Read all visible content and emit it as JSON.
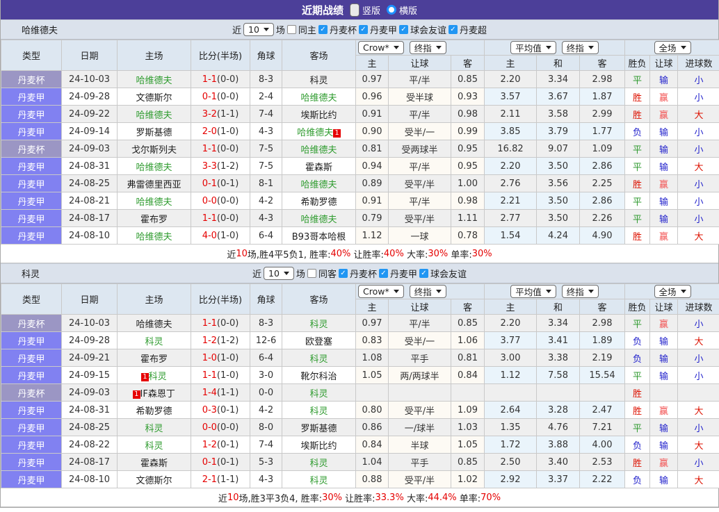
{
  "title_bar": {
    "title": "近期战绩",
    "vertical_label": "竖版",
    "horizontal_label": "横版"
  },
  "table_header": {
    "type": "类型",
    "date": "日期",
    "home": "主场",
    "score": "比分(半场)",
    "corner": "角球",
    "away": "客场",
    "crow_select": "Crow*",
    "final_select": "终指",
    "avg_select": "平均值",
    "full_select": "全场",
    "sub": {
      "home": "主",
      "handicap": "让球",
      "away": "客",
      "avg_home": "主",
      "avg_draw": "和",
      "avg_away": "客",
      "result": "胜负",
      "handicap_result": "让球",
      "goals": "进球数"
    }
  },
  "colors": {
    "accent_purple": "#4c3f99",
    "league_cup": "#9b96c4",
    "league_jia": "#8181f1",
    "team_green": "#2e9b2e",
    "score_red": "#e50000",
    "win_red": "#dd1100",
    "lose_blue": "#2222cc",
    "draw_green": "#2f9a2f",
    "checkbox_blue": "#2196f3"
  },
  "sections": [
    {
      "team": "哈维德夫",
      "filter": {
        "near_label": "近",
        "count": "10",
        "games_label": "场",
        "same_label": "同主",
        "same_checked": false,
        "leagues": [
          {
            "label": "丹麦杯",
            "checked": true
          },
          {
            "label": "丹麦甲",
            "checked": true
          },
          {
            "label": "球会友谊",
            "checked": true
          },
          {
            "label": "丹麦超",
            "checked": true
          }
        ]
      },
      "rows": [
        {
          "league": "丹麦杯",
          "league_type": "cup",
          "date": "24-10-03",
          "home": "哈维德夫",
          "home_green": true,
          "home_badge": "",
          "home_badge_pos": "",
          "score": "1-1",
          "half": "(0-0)",
          "corner": "8-3",
          "away": "科灵",
          "away_green": false,
          "away_badge": "",
          "away_badge_pos": "",
          "crow_home": "0.97",
          "handicap": "平/半",
          "crow_away": "0.85",
          "avg_home": "2.20",
          "avg_draw": "3.34",
          "avg_away": "2.98",
          "result": "平",
          "result_color": "green",
          "handicap_result": "输",
          "handicap_result_color": "blue",
          "goals": "小",
          "goals_color": "blue"
        },
        {
          "league": "丹麦甲",
          "league_type": "jia",
          "date": "24-09-28",
          "home": "文德斯尔",
          "home_green": false,
          "home_badge": "",
          "home_badge_pos": "",
          "score": "0-1",
          "half": "(0-0)",
          "corner": "2-4",
          "away": "哈维德夫",
          "away_green": true,
          "away_badge": "",
          "away_badge_pos": "",
          "crow_home": "0.96",
          "handicap": "受半球",
          "crow_away": "0.93",
          "avg_home": "3.57",
          "avg_draw": "3.67",
          "avg_away": "1.87",
          "result": "胜",
          "result_color": "red",
          "handicap_result": "赢",
          "handicap_result_color": "lightred",
          "goals": "小",
          "goals_color": "blue"
        },
        {
          "league": "丹麦甲",
          "league_type": "jia",
          "date": "24-09-22",
          "home": "哈维德夫",
          "home_green": true,
          "home_badge": "",
          "home_badge_pos": "",
          "score": "3-2",
          "half": "(1-1)",
          "corner": "7-4",
          "away": "埃斯比约",
          "away_green": false,
          "away_badge": "",
          "away_badge_pos": "",
          "crow_home": "0.91",
          "handicap": "平/半",
          "crow_away": "0.98",
          "avg_home": "2.11",
          "avg_draw": "3.58",
          "avg_away": "2.99",
          "result": "胜",
          "result_color": "red",
          "handicap_result": "赢",
          "handicap_result_color": "lightred",
          "goals": "大",
          "goals_color": "red"
        },
        {
          "league": "丹麦甲",
          "league_type": "jia",
          "date": "24-09-14",
          "home": "罗斯基德",
          "home_green": false,
          "home_badge": "",
          "home_badge_pos": "",
          "score": "2-0",
          "half": "(1-0)",
          "corner": "4-3",
          "away": "哈维德夫",
          "away_green": true,
          "away_badge": "1",
          "away_badge_pos": "a",
          "crow_home": "0.90",
          "handicap": "受半/一",
          "crow_away": "0.99",
          "avg_home": "3.85",
          "avg_draw": "3.79",
          "avg_away": "1.77",
          "result": "负",
          "result_color": "blue",
          "handicap_result": "输",
          "handicap_result_color": "blue",
          "goals": "小",
          "goals_color": "blue"
        },
        {
          "league": "丹麦杯",
          "league_type": "cup",
          "date": "24-09-03",
          "home": "戈尔斯列夫",
          "home_green": false,
          "home_badge": "",
          "home_badge_pos": "",
          "score": "1-1",
          "half": "(0-0)",
          "corner": "7-5",
          "away": "哈维德夫",
          "away_green": true,
          "away_badge": "",
          "away_badge_pos": "",
          "crow_home": "0.81",
          "handicap": "受两球半",
          "crow_away": "0.95",
          "avg_home": "16.82",
          "avg_draw": "9.07",
          "avg_away": "1.09",
          "result": "平",
          "result_color": "green",
          "handicap_result": "输",
          "handicap_result_color": "blue",
          "goals": "小",
          "goals_color": "blue"
        },
        {
          "league": "丹麦甲",
          "league_type": "jia",
          "date": "24-08-31",
          "home": "哈维德夫",
          "home_green": true,
          "home_badge": "",
          "home_badge_pos": "",
          "score": "3-3",
          "half": "(1-2)",
          "corner": "7-5",
          "away": "霍森斯",
          "away_green": false,
          "away_badge": "",
          "away_badge_pos": "",
          "crow_home": "0.94",
          "handicap": "平/半",
          "crow_away": "0.95",
          "avg_home": "2.20",
          "avg_draw": "3.50",
          "avg_away": "2.86",
          "result": "平",
          "result_color": "green",
          "handicap_result": "输",
          "handicap_result_color": "blue",
          "goals": "大",
          "goals_color": "red"
        },
        {
          "league": "丹麦甲",
          "league_type": "jia",
          "date": "24-08-25",
          "home": "弗雷德里西亚",
          "home_green": false,
          "home_badge": "",
          "home_badge_pos": "",
          "score": "0-1",
          "half": "(0-1)",
          "corner": "8-1",
          "away": "哈维德夫",
          "away_green": true,
          "away_badge": "",
          "away_badge_pos": "",
          "crow_home": "0.89",
          "handicap": "受平/半",
          "crow_away": "1.00",
          "avg_home": "2.76",
          "avg_draw": "3.56",
          "avg_away": "2.25",
          "result": "胜",
          "result_color": "red",
          "handicap_result": "赢",
          "handicap_result_color": "lightred",
          "goals": "小",
          "goals_color": "blue"
        },
        {
          "league": "丹麦甲",
          "league_type": "jia",
          "date": "24-08-21",
          "home": "哈维德夫",
          "home_green": true,
          "home_badge": "",
          "home_badge_pos": "",
          "score": "0-0",
          "half": "(0-0)",
          "corner": "4-2",
          "away": "希勒罗德",
          "away_green": false,
          "away_badge": "",
          "away_badge_pos": "",
          "crow_home": "0.91",
          "handicap": "平/半",
          "crow_away": "0.98",
          "avg_home": "2.21",
          "avg_draw": "3.50",
          "avg_away": "2.86",
          "result": "平",
          "result_color": "green",
          "handicap_result": "输",
          "handicap_result_color": "blue",
          "goals": "小",
          "goals_color": "blue"
        },
        {
          "league": "丹麦甲",
          "league_type": "jia",
          "date": "24-08-17",
          "home": "霍布罗",
          "home_green": false,
          "home_badge": "",
          "home_badge_pos": "",
          "score": "1-1",
          "half": "(0-0)",
          "corner": "4-3",
          "away": "哈维德夫",
          "away_green": true,
          "away_badge": "",
          "away_badge_pos": "",
          "crow_home": "0.79",
          "handicap": "受平/半",
          "crow_away": "1.11",
          "avg_home": "2.77",
          "avg_draw": "3.50",
          "avg_away": "2.26",
          "result": "平",
          "result_color": "green",
          "handicap_result": "输",
          "handicap_result_color": "blue",
          "goals": "小",
          "goals_color": "blue"
        },
        {
          "league": "丹麦甲",
          "league_type": "jia",
          "date": "24-08-10",
          "home": "哈维德夫",
          "home_green": true,
          "home_badge": "",
          "home_badge_pos": "",
          "score": "4-0",
          "half": "(1-0)",
          "corner": "6-4",
          "away": "B93哥本哈根",
          "away_green": false,
          "away_badge": "",
          "away_badge_pos": "",
          "crow_home": "1.12",
          "handicap": "一球",
          "crow_away": "0.78",
          "avg_home": "1.54",
          "avg_draw": "4.24",
          "avg_away": "4.90",
          "result": "胜",
          "result_color": "red",
          "handicap_result": "赢",
          "handicap_result_color": "lightred",
          "goals": "大",
          "goals_color": "red"
        }
      ],
      "summary": [
        {
          "text": "近",
          "color": "dark"
        },
        {
          "text": "10",
          "color": "red"
        },
        {
          "text": "场,胜4平5负1, 胜率:",
          "color": "dark"
        },
        {
          "text": "40%",
          "color": "red"
        },
        {
          "text": " 让胜率:",
          "color": "dark"
        },
        {
          "text": "40%",
          "color": "red"
        },
        {
          "text": " 大率:",
          "color": "dark"
        },
        {
          "text": "30%",
          "color": "red"
        },
        {
          "text": " 单率:",
          "color": "dark"
        },
        {
          "text": "30%",
          "color": "red"
        }
      ]
    },
    {
      "team": "科灵",
      "filter": {
        "near_label": "近",
        "count": "10",
        "games_label": "场",
        "same_label": "同客",
        "same_checked": false,
        "leagues": [
          {
            "label": "丹麦杯",
            "checked": true
          },
          {
            "label": "丹麦甲",
            "checked": true
          },
          {
            "label": "球会友谊",
            "checked": true
          }
        ]
      },
      "rows": [
        {
          "league": "丹麦杯",
          "league_type": "cup",
          "date": "24-10-03",
          "home": "哈维德夫",
          "home_green": false,
          "home_badge": "",
          "home_badge_pos": "",
          "score": "1-1",
          "half": "(0-0)",
          "corner": "8-3",
          "away": "科灵",
          "away_green": true,
          "away_badge": "",
          "away_badge_pos": "",
          "crow_home": "0.97",
          "handicap": "平/半",
          "crow_away": "0.85",
          "avg_home": "2.20",
          "avg_draw": "3.34",
          "avg_away": "2.98",
          "result": "平",
          "result_color": "green",
          "handicap_result": "赢",
          "handicap_result_color": "lightred",
          "goals": "小",
          "goals_color": "blue"
        },
        {
          "league": "丹麦甲",
          "league_type": "jia",
          "date": "24-09-28",
          "home": "科灵",
          "home_green": true,
          "home_badge": "",
          "home_badge_pos": "",
          "score": "1-2",
          "half": "(1-2)",
          "corner": "12-6",
          "away": "欧登塞",
          "away_green": false,
          "away_badge": "",
          "away_badge_pos": "",
          "crow_home": "0.83",
          "handicap": "受半/一",
          "crow_away": "1.06",
          "avg_home": "3.77",
          "avg_draw": "3.41",
          "avg_away": "1.89",
          "result": "负",
          "result_color": "blue",
          "handicap_result": "输",
          "handicap_result_color": "blue",
          "goals": "大",
          "goals_color": "red"
        },
        {
          "league": "丹麦甲",
          "league_type": "jia",
          "date": "24-09-21",
          "home": "霍布罗",
          "home_green": false,
          "home_badge": "",
          "home_badge_pos": "",
          "score": "1-0",
          "half": "(1-0)",
          "corner": "6-4",
          "away": "科灵",
          "away_green": true,
          "away_badge": "",
          "away_badge_pos": "",
          "crow_home": "1.08",
          "handicap": "平手",
          "crow_away": "0.81",
          "avg_home": "3.00",
          "avg_draw": "3.38",
          "avg_away": "2.19",
          "result": "负",
          "result_color": "blue",
          "handicap_result": "输",
          "handicap_result_color": "blue",
          "goals": "小",
          "goals_color": "blue"
        },
        {
          "league": "丹麦甲",
          "league_type": "jia",
          "date": "24-09-15",
          "home": "科灵",
          "home_green": true,
          "home_badge": "1",
          "home_badge_pos": "b",
          "score": "1-1",
          "half": "(1-0)",
          "corner": "3-0",
          "away": "靴尔科治",
          "away_green": false,
          "away_badge": "",
          "away_badge_pos": "",
          "crow_home": "1.05",
          "handicap": "两/两球半",
          "crow_away": "0.84",
          "avg_home": "1.12",
          "avg_draw": "7.58",
          "avg_away": "15.54",
          "result": "平",
          "result_color": "green",
          "handicap_result": "输",
          "handicap_result_color": "blue",
          "goals": "小",
          "goals_color": "blue"
        },
        {
          "league": "丹麦杯",
          "league_type": "cup",
          "date": "24-09-03",
          "home": "IF森恩丁",
          "home_green": false,
          "home_badge": "1",
          "home_badge_pos": "b",
          "score": "1-4",
          "half": "(1-1)",
          "corner": "0-0",
          "away": "科灵",
          "away_green": true,
          "away_badge": "",
          "away_badge_pos": "",
          "crow_home": "",
          "handicap": "",
          "crow_away": "",
          "avg_home": "",
          "avg_draw": "",
          "avg_away": "",
          "result": "胜",
          "result_color": "red",
          "handicap_result": "",
          "handicap_result_color": "",
          "goals": "",
          "goals_color": ""
        },
        {
          "league": "丹麦甲",
          "league_type": "jia",
          "date": "24-08-31",
          "home": "希勒罗德",
          "home_green": false,
          "home_badge": "",
          "home_badge_pos": "",
          "score": "0-3",
          "half": "(0-1)",
          "corner": "4-2",
          "away": "科灵",
          "away_green": true,
          "away_badge": "",
          "away_badge_pos": "",
          "crow_home": "0.80",
          "handicap": "受平/半",
          "crow_away": "1.09",
          "avg_home": "2.64",
          "avg_draw": "3.28",
          "avg_away": "2.47",
          "result": "胜",
          "result_color": "red",
          "handicap_result": "赢",
          "handicap_result_color": "lightred",
          "goals": "大",
          "goals_color": "red"
        },
        {
          "league": "丹麦甲",
          "league_type": "jia",
          "date": "24-08-25",
          "home": "科灵",
          "home_green": true,
          "home_badge": "",
          "home_badge_pos": "",
          "score": "0-0",
          "half": "(0-0)",
          "corner": "8-0",
          "away": "罗斯基德",
          "away_green": false,
          "away_badge": "",
          "away_badge_pos": "",
          "crow_home": "0.86",
          "handicap": "一/球半",
          "crow_away": "1.03",
          "avg_home": "1.35",
          "avg_draw": "4.76",
          "avg_away": "7.21",
          "result": "平",
          "result_color": "green",
          "handicap_result": "输",
          "handicap_result_color": "blue",
          "goals": "小",
          "goals_color": "blue"
        },
        {
          "league": "丹麦甲",
          "league_type": "jia",
          "date": "24-08-22",
          "home": "科灵",
          "home_green": true,
          "home_badge": "",
          "home_badge_pos": "",
          "score": "1-2",
          "half": "(0-1)",
          "corner": "7-4",
          "away": "埃斯比约",
          "away_green": false,
          "away_badge": "",
          "away_badge_pos": "",
          "crow_home": "0.84",
          "handicap": "半球",
          "crow_away": "1.05",
          "avg_home": "1.72",
          "avg_draw": "3.88",
          "avg_away": "4.00",
          "result": "负",
          "result_color": "blue",
          "handicap_result": "输",
          "handicap_result_color": "blue",
          "goals": "大",
          "goals_color": "red"
        },
        {
          "league": "丹麦甲",
          "league_type": "jia",
          "date": "24-08-17",
          "home": "霍森斯",
          "home_green": false,
          "home_badge": "",
          "home_badge_pos": "",
          "score": "0-1",
          "half": "(0-1)",
          "corner": "5-3",
          "away": "科灵",
          "away_green": true,
          "away_badge": "",
          "away_badge_pos": "",
          "crow_home": "1.04",
          "handicap": "平手",
          "crow_away": "0.85",
          "avg_home": "2.50",
          "avg_draw": "3.40",
          "avg_away": "2.53",
          "result": "胜",
          "result_color": "red",
          "handicap_result": "赢",
          "handicap_result_color": "lightred",
          "goals": "小",
          "goals_color": "blue"
        },
        {
          "league": "丹麦甲",
          "league_type": "jia",
          "date": "24-08-10",
          "home": "文德斯尔",
          "home_green": false,
          "home_badge": "",
          "home_badge_pos": "",
          "score": "2-1",
          "half": "(1-1)",
          "corner": "4-3",
          "away": "科灵",
          "away_green": true,
          "away_badge": "",
          "away_badge_pos": "",
          "crow_home": "0.88",
          "handicap": "受平/半",
          "crow_away": "1.02",
          "avg_home": "2.92",
          "avg_draw": "3.37",
          "avg_away": "2.22",
          "result": "负",
          "result_color": "blue",
          "handicap_result": "输",
          "handicap_result_color": "blue",
          "goals": "大",
          "goals_color": "red"
        }
      ],
      "summary": [
        {
          "text": "近",
          "color": "dark"
        },
        {
          "text": "10",
          "color": "red"
        },
        {
          "text": "场,胜3平3负4, 胜率:",
          "color": "dark"
        },
        {
          "text": "30%",
          "color": "red"
        },
        {
          "text": " 让胜率:",
          "color": "dark"
        },
        {
          "text": "33.3%",
          "color": "red"
        },
        {
          "text": " 大率:",
          "color": "dark"
        },
        {
          "text": "44.4%",
          "color": "red"
        },
        {
          "text": " 单率:",
          "color": "dark"
        },
        {
          "text": "70%",
          "color": "red"
        }
      ]
    }
  ]
}
